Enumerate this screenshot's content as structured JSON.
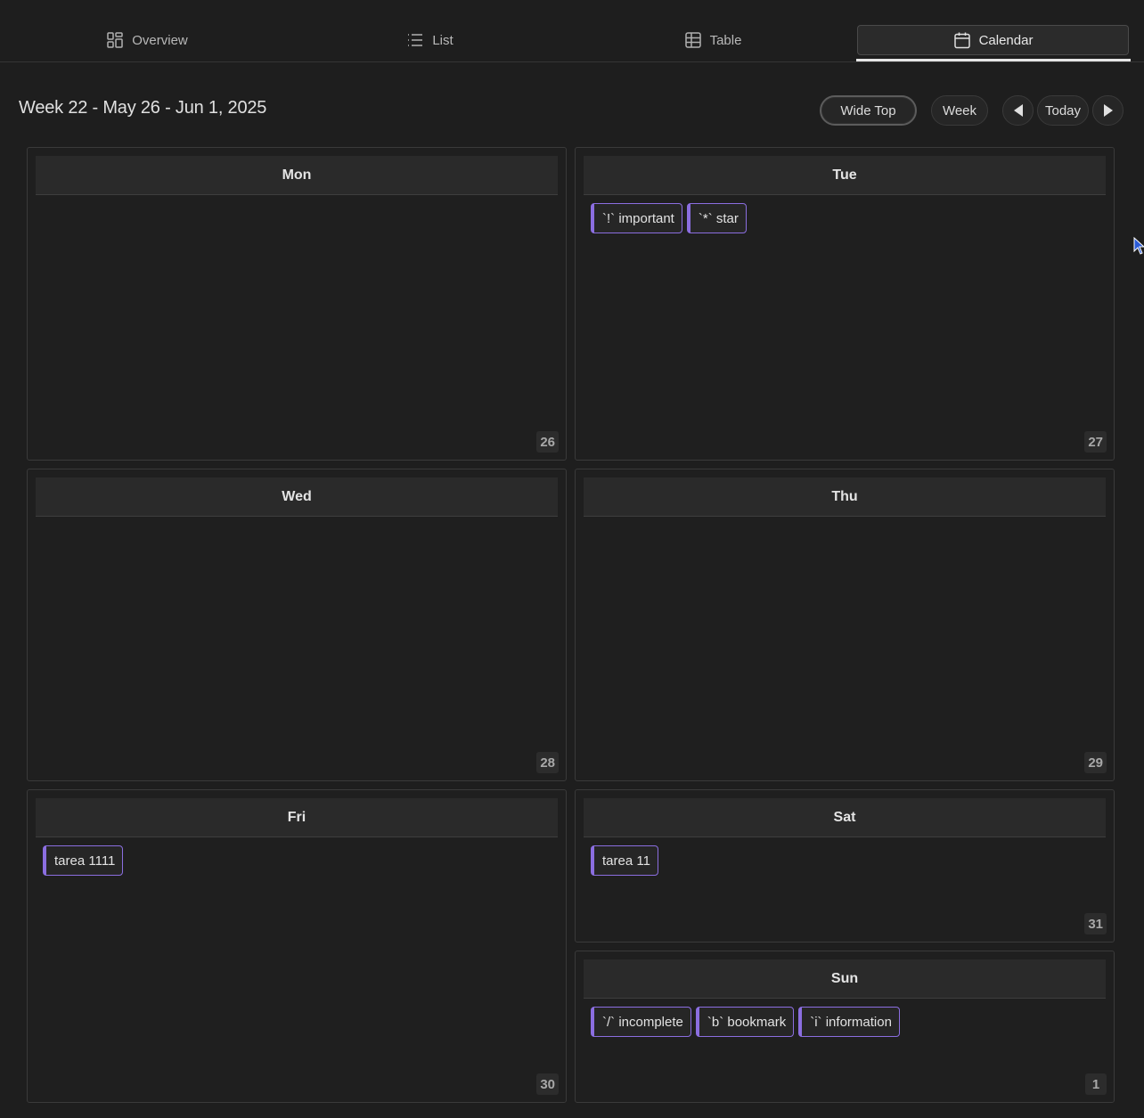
{
  "tabs": [
    {
      "label": "Overview",
      "icon": "grid-icon"
    },
    {
      "label": "List",
      "icon": "list-icon"
    },
    {
      "label": "Table",
      "icon": "table-icon"
    },
    {
      "label": "Calendar",
      "icon": "calendar-icon",
      "active": true
    }
  ],
  "toolbar": {
    "title": "Week 22 - May 26 - Jun 1, 2025",
    "layout_label": "Wide Top",
    "view_label": "Week",
    "today_label": "Today"
  },
  "days": {
    "mon": {
      "name": "Mon",
      "date": "26",
      "tasks": []
    },
    "tue": {
      "name": "Tue",
      "date": "27",
      "tasks": [
        "`!` important",
        "`*` star"
      ]
    },
    "wed": {
      "name": "Wed",
      "date": "28",
      "tasks": []
    },
    "thu": {
      "name": "Thu",
      "date": "29",
      "tasks": []
    },
    "fri": {
      "name": "Fri",
      "date": "30",
      "tasks": [
        "tarea 1111"
      ]
    },
    "sat": {
      "name": "Sat",
      "date": "31",
      "tasks": [
        "tarea 11"
      ]
    },
    "sun": {
      "name": "Sun",
      "date": "1",
      "tasks": [
        "`/` incomplete",
        "`b` bookmark",
        "`i` information"
      ]
    }
  },
  "colors": {
    "background": "#1e1e1e",
    "task_accent": "#8b6ee0",
    "header_bg": "#2a2a2a"
  }
}
